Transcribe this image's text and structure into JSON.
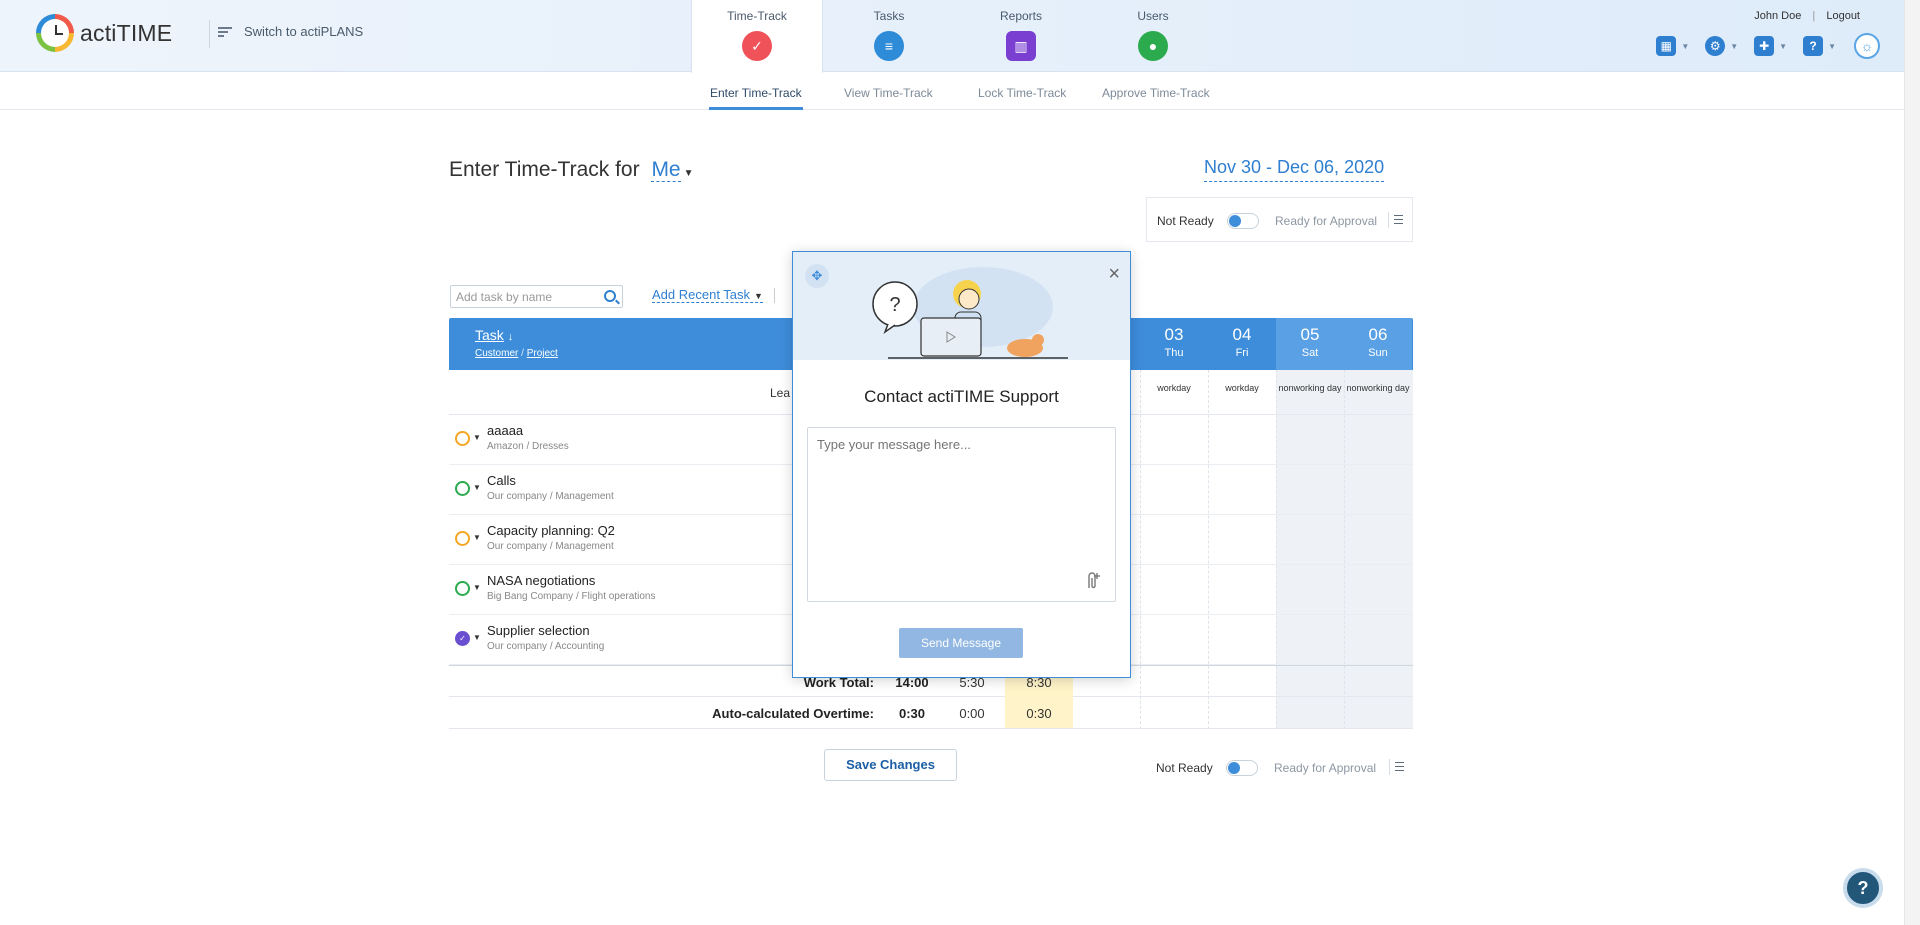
{
  "app": {
    "logo_text": "actiTIME",
    "switch_label": "Switch to actiPLANS"
  },
  "nav": {
    "tabs": [
      {
        "label": "Time-Track",
        "active": true
      },
      {
        "label": "Tasks"
      },
      {
        "label": "Reports"
      },
      {
        "label": "Users"
      }
    ],
    "user_name": "John Doe",
    "separator": "|",
    "logout": "Logout"
  },
  "subnav": {
    "items": [
      "Enter Time-Track",
      "View Time-Track",
      "Lock Time-Track",
      "Approve Time-Track"
    ],
    "active": 0
  },
  "page": {
    "title_prefix": "Enter Time-Track for",
    "user_select": "Me",
    "week_range": "Nov 30 - Dec 06, 2020"
  },
  "approval": {
    "not_ready": "Not Ready",
    "ready": "Ready for Approval"
  },
  "toolbar": {
    "add_task_placeholder": "Add task by name",
    "add_recent": "Add Recent Task"
  },
  "grid": {
    "task_header": "Task",
    "sub_customer": "Customer",
    "sub_sep": "/",
    "sub_project": "Project",
    "partial_label": "Lea",
    "days": [
      {
        "num": "03",
        "name": "Thu",
        "kind": "workday",
        "weekend": false
      },
      {
        "num": "04",
        "name": "Fri",
        "kind": "workday",
        "weekend": false
      },
      {
        "num": "05",
        "name": "Sat",
        "kind": "nonworking day",
        "weekend": true
      },
      {
        "num": "06",
        "name": "Sun",
        "kind": "nonworking day",
        "weekend": true
      }
    ],
    "tasks": [
      {
        "name": "aaaaa",
        "customer": "Amazon",
        "project": "Dresses",
        "status": "yellow"
      },
      {
        "name": "Calls",
        "customer": "Our company",
        "project": "Management",
        "status": "green"
      },
      {
        "name": "Capacity planning: Q2",
        "customer": "Our company",
        "project": "Management",
        "status": "yellow"
      },
      {
        "name": "NASA negotiations",
        "customer": "Big Bang Company",
        "project": "Flight operations",
        "status": "green"
      },
      {
        "name": "Supplier selection",
        "customer": "Our company",
        "project": "Accounting",
        "status": "done"
      }
    ],
    "work_total": {
      "label": "Work Total:",
      "values": [
        "14:00",
        "5:30",
        "8:30"
      ]
    },
    "overtime": {
      "label": "Auto-calculated Overtime:",
      "values": [
        "0:30",
        "0:00",
        "0:30"
      ]
    }
  },
  "save_button": "Save Changes",
  "help_fab": "?",
  "modal": {
    "title": "Contact actiTIME Support",
    "placeholder": "Type your message here...",
    "send": "Send Message",
    "close": "×",
    "bubble": "?"
  },
  "colors": {
    "accent": "#3d8ddb",
    "header_bg": "#e6f0fb",
    "today_highlight": "#fff4c9"
  }
}
